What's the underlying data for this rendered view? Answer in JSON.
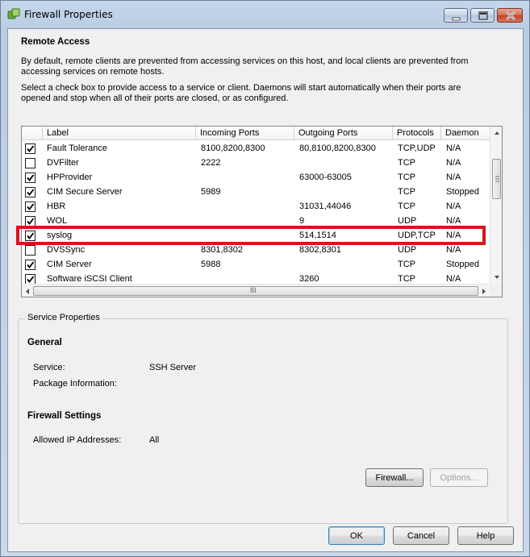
{
  "window": {
    "title": "Firewall Properties"
  },
  "remote_access": {
    "heading": "Remote Access",
    "intro": "By default, remote clients are prevented from accessing services on this host, and local clients are prevented from accessing services on remote hosts.",
    "instructions": "Select a check box to provide access to a service or client. Daemons will start automatically when their ports are opened and stop when all of their ports are closed, or as configured."
  },
  "table": {
    "columns": [
      "Label",
      "Incoming Ports",
      "Outgoing Ports",
      "Protocols",
      "Daemon"
    ],
    "rows": [
      {
        "checked": true,
        "label": "Fault Tolerance",
        "incoming": "8100,8200,8300",
        "outgoing": "80,8100,8200,8300",
        "protocols": "TCP,UDP",
        "daemon": "N/A"
      },
      {
        "checked": false,
        "label": "DVFilter",
        "incoming": "2222",
        "outgoing": "",
        "protocols": "TCP",
        "daemon": "N/A"
      },
      {
        "checked": true,
        "label": "HPProvider",
        "incoming": "",
        "outgoing": "63000-63005",
        "protocols": "TCP",
        "daemon": "N/A"
      },
      {
        "checked": true,
        "label": "CIM Secure Server",
        "incoming": "5989",
        "outgoing": "",
        "protocols": "TCP",
        "daemon": "Stopped"
      },
      {
        "checked": true,
        "label": "HBR",
        "incoming": "",
        "outgoing": "31031,44046",
        "protocols": "TCP",
        "daemon": "N/A"
      },
      {
        "checked": true,
        "label": "WOL",
        "incoming": "",
        "outgoing": "9",
        "protocols": "UDP",
        "daemon": "N/A"
      },
      {
        "checked": true,
        "label": "syslog",
        "incoming": "",
        "outgoing": "514,1514",
        "protocols": "UDP,TCP",
        "daemon": "N/A"
      },
      {
        "checked": false,
        "label": "DVSSync",
        "incoming": "8301,8302",
        "outgoing": "8302,8301",
        "protocols": "UDP",
        "daemon": "N/A"
      },
      {
        "checked": true,
        "label": "CIM Server",
        "incoming": "5988",
        "outgoing": "",
        "protocols": "TCP",
        "daemon": "Stopped"
      },
      {
        "checked": true,
        "label": "Software iSCSI Client",
        "incoming": "",
        "outgoing": "3260",
        "protocols": "TCP",
        "daemon": "N/A"
      }
    ],
    "highlighted_row": "syslog",
    "highlight_color": "#d9141b",
    "hscroll_grip": "III"
  },
  "service_properties": {
    "legend": "Service Properties",
    "general_heading": "General",
    "service_label": "Service:",
    "service_value": "SSH Server",
    "package_label": "Package Information:",
    "package_value": "",
    "firewall_heading": "Firewall Settings",
    "allowed_ip_label": "Allowed IP Addresses:",
    "allowed_ip_value": "All",
    "firewall_button": "Firewall...",
    "options_button": "Options..."
  },
  "footer": {
    "ok": "OK",
    "cancel": "Cancel",
    "help": "Help"
  }
}
